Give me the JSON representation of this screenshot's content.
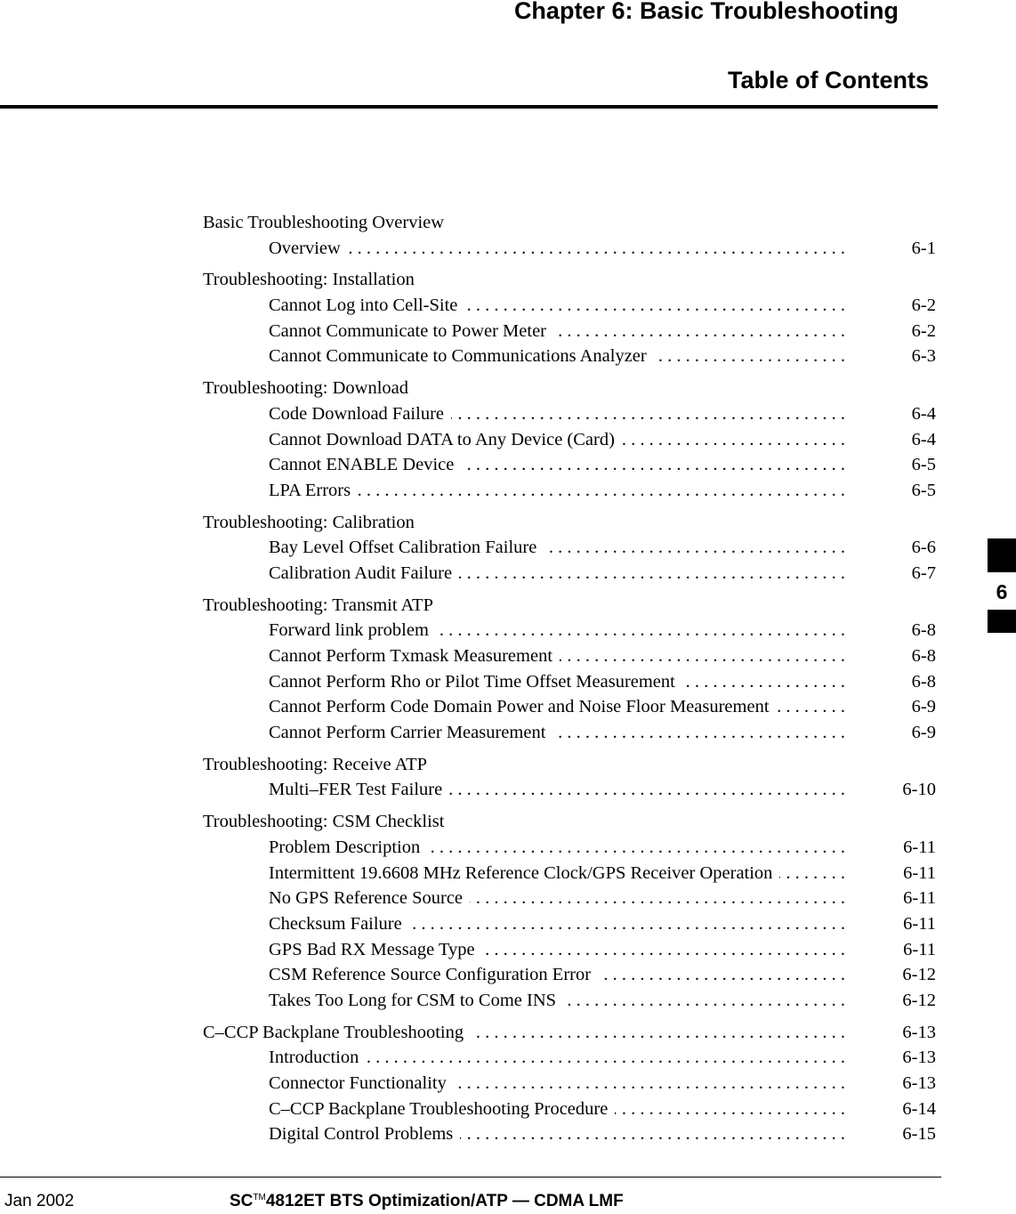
{
  "header": {
    "chapter": "Chapter 6: Basic Troubleshooting",
    "section_title": "Table of Contents"
  },
  "toc": [
    {
      "heading": "Basic Troubleshooting Overview",
      "page": "",
      "items": [
        {
          "label": "Overview",
          "page": "6-1"
        }
      ]
    },
    {
      "heading": "Troubleshooting: Installation",
      "page": "",
      "items": [
        {
          "label": "Cannot Log into Cell-Site",
          "page": "6-2"
        },
        {
          "label": "Cannot Communicate to Power Meter",
          "page": "6-2"
        },
        {
          "label": "Cannot Communicate to Communications Analyzer",
          "page": "6-3"
        }
      ]
    },
    {
      "heading": "Troubleshooting: Download",
      "page": "",
      "items": [
        {
          "label": "Code Download Failure",
          "page": "6-4"
        },
        {
          "label": "Cannot Download DATA to Any Device (Card)",
          "page": "6-4"
        },
        {
          "label": "Cannot ENABLE Device",
          "page": "6-5"
        },
        {
          "label": "LPA Errors",
          "page": "6-5"
        }
      ]
    },
    {
      "heading": "Troubleshooting: Calibration",
      "page": "",
      "items": [
        {
          "label": "Bay Level Offset Calibration Failure",
          "page": "6-6"
        },
        {
          "label": "Calibration Audit Failure",
          "page": "6-7"
        }
      ]
    },
    {
      "heading": "Troubleshooting: Transmit ATP",
      "page": "",
      "items": [
        {
          "label": "Forward link problem",
          "page": "6-8"
        },
        {
          "label": "Cannot Perform Txmask Measurement",
          "page": "6-8"
        },
        {
          "label": "Cannot Perform Rho or Pilot Time Offset Measurement",
          "page": "6-8"
        },
        {
          "label": "Cannot Perform Code Domain Power and Noise Floor Measurement",
          "page": "6-9"
        },
        {
          "label": "Cannot Perform Carrier Measurement",
          "page": "6-9"
        }
      ]
    },
    {
      "heading": "Troubleshooting: Receive ATP",
      "page": "",
      "items": [
        {
          "label": "Multi–FER Test Failure",
          "page": "6-10"
        }
      ]
    },
    {
      "heading": "Troubleshooting: CSM Checklist",
      "page": "",
      "items": [
        {
          "label": "Problem Description",
          "page": "6-11"
        },
        {
          "label": "Intermittent 19.6608 MHz Reference Clock/GPS Receiver Operation",
          "page": "6-11"
        },
        {
          "label": "No GPS Reference Source",
          "page": "6-11"
        },
        {
          "label": "Checksum Failure",
          "page": "6-11"
        },
        {
          "label": "GPS Bad RX Message Type",
          "page": "6-11"
        },
        {
          "label": "CSM Reference Source Configuration Error",
          "page": "6-12"
        },
        {
          "label": "Takes Too Long for CSM to Come INS",
          "page": "6-12"
        }
      ]
    },
    {
      "heading": "C–CCP Backplane Troubleshooting",
      "page": "6-13",
      "items": [
        {
          "label": "Introduction",
          "page": "6-13"
        },
        {
          "label": "Connector Functionality",
          "page": "6-13"
        },
        {
          "label": "C–CCP Backplane Troubleshooting Procedure",
          "page": "6-14"
        },
        {
          "label": "Digital Control Problems",
          "page": "6-15"
        }
      ]
    }
  ],
  "leader": ". . . . . . . . . . . . . . . . . . . . . . . . . . . . . . . . . . . . . . . . . . . . . . . . . . . . . . . . . . . . . . . .",
  "chapter_tab": {
    "number": "6"
  },
  "footer": {
    "date": "Jan 2002",
    "title_prefix": "SC",
    "trademark": "TM",
    "title_rest": "4812ET BTS Optimization/ATP — CDMA LMF"
  }
}
